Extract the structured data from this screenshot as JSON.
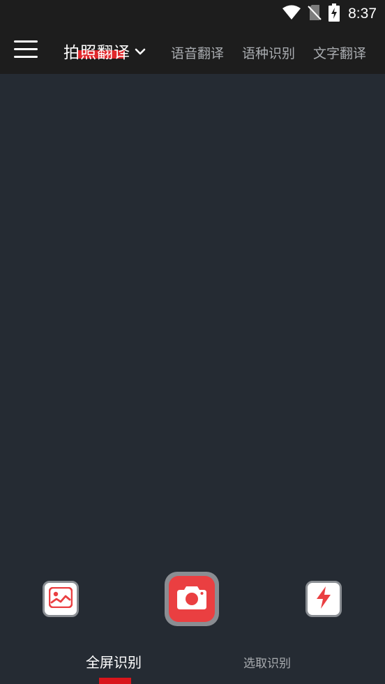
{
  "status_bar": {
    "time": "8:37",
    "icons": [
      "wifi-icon",
      "no-sim-icon",
      "battery-charging-icon"
    ]
  },
  "toolbar": {
    "menu_icon": "hamburger-menu-icon",
    "current_mode": "拍照翻译",
    "dropdown_icon": "chevron-down-icon",
    "tabs": [
      {
        "label": "语音翻译"
      },
      {
        "label": "语种识别"
      },
      {
        "label": "文字翻译"
      }
    ]
  },
  "controls": {
    "gallery_icon": "image-gallery-icon",
    "shutter_icon": "camera-icon",
    "flash_icon": "flash-icon"
  },
  "bottom_tabs": {
    "items": [
      {
        "label": "全屏识别",
        "active": true
      },
      {
        "label": "选取识别",
        "active": false
      }
    ]
  },
  "colors": {
    "accent": "#e0282c",
    "shutter": "#ea3f41",
    "background": "#252b33",
    "toolbar": "#1d1d1d"
  }
}
